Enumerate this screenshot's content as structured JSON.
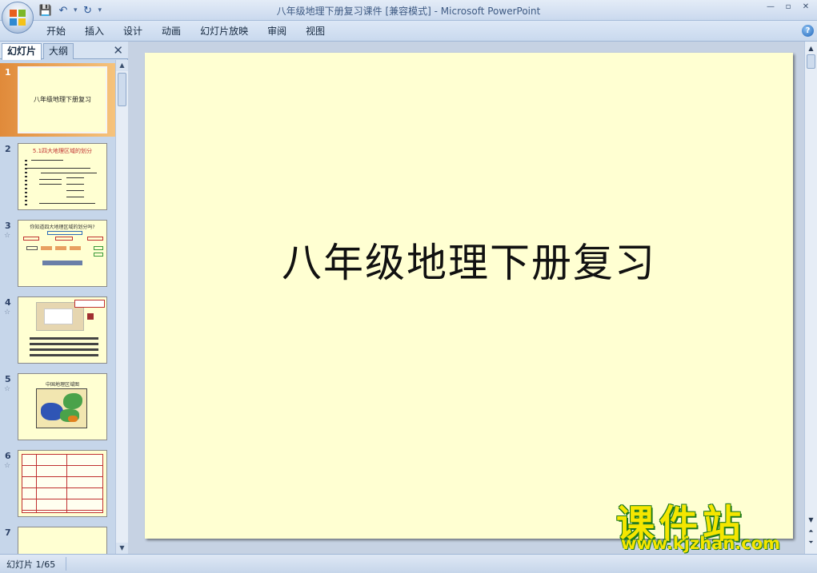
{
  "window": {
    "title": "八年级地理下册复习课件 [兼容模式] - Microsoft PowerPoint",
    "minimize": "—",
    "restore": "▫",
    "close": "✕"
  },
  "qat": {
    "save": "💾",
    "undo": "↶",
    "undo_dd": "▾",
    "redo": "↻",
    "customize": "▾"
  },
  "ribbon": {
    "tabs": [
      "开始",
      "插入",
      "设计",
      "动画",
      "幻灯片放映",
      "审阅",
      "视图"
    ],
    "help": "?"
  },
  "left_panel": {
    "tabs": [
      "幻灯片",
      "大纲"
    ],
    "close": "✕",
    "slides": [
      {
        "num": "1",
        "title": "八年级地理下册复习",
        "star": ""
      },
      {
        "num": "2",
        "title": "5.1四大地理区域的划分",
        "star": ""
      },
      {
        "num": "3",
        "title": "你知道四大地理区域的划分吗?",
        "star": "☆"
      },
      {
        "num": "4",
        "title": "",
        "star": "☆"
      },
      {
        "num": "5",
        "title": "中国地理区域图",
        "star": "☆"
      },
      {
        "num": "6",
        "title": "",
        "star": "☆"
      },
      {
        "num": "7",
        "title": "",
        "star": ""
      }
    ],
    "scroll_up": "▲",
    "scroll_down": "▼"
  },
  "slide": {
    "title": "八年级地理下册复习"
  },
  "watermark": {
    "cn": "课件站",
    "url": "www.kjzhan.com"
  },
  "status": {
    "slide_counter": "幻灯片 1/65"
  },
  "colors": {
    "slide_bg": "#ffffd2",
    "selection": "#e08a3a",
    "ribbon": "#c9d9ee"
  }
}
